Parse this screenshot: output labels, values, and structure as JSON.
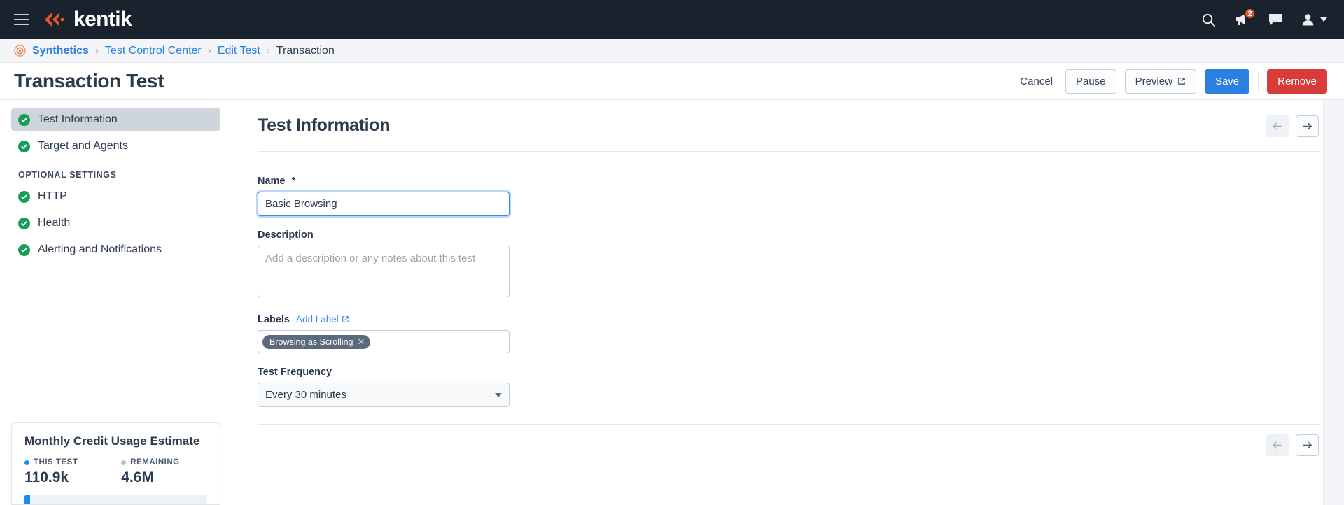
{
  "topbar": {
    "menu_icon": "hamburger-icon",
    "brand": "kentik",
    "icons": [
      {
        "name": "search-icon"
      },
      {
        "name": "megaphone-icon",
        "badge": "2"
      },
      {
        "name": "chat-icon"
      },
      {
        "name": "user-avatar-icon"
      }
    ]
  },
  "breadcrumb": {
    "app_icon": "synthetics-icon",
    "items": [
      {
        "label": "Synthetics",
        "type": "link"
      },
      {
        "label": "Test Control Center",
        "type": "link"
      },
      {
        "label": "Edit Test",
        "type": "link"
      },
      {
        "label": "Transaction",
        "type": "current"
      }
    ],
    "separator": "›"
  },
  "page": {
    "title": "Transaction Test",
    "actions": {
      "cancel": "Cancel",
      "pause": "Pause",
      "preview": "Preview",
      "save": "Save",
      "remove": "Remove"
    }
  },
  "sidebar": {
    "items": [
      {
        "label": "Test Information",
        "status": "complete",
        "active": true
      },
      {
        "label": "Target and Agents",
        "status": "complete",
        "active": false
      }
    ],
    "optional_group_title": "OPTIONAL SETTINGS",
    "optional_items": [
      {
        "label": "HTTP",
        "status": "complete"
      },
      {
        "label": "Health",
        "status": "complete"
      },
      {
        "label": "Alerting and Notifications",
        "status": "complete"
      }
    ],
    "credit_card": {
      "title": "Monthly Credit Usage Estimate",
      "this_test_label": "THIS TEST",
      "this_test_value": "110.9k",
      "remaining_label": "REMAINING",
      "remaining_value": "4.6M",
      "progress_percent": 3,
      "this_test_color": "#1a8cf0",
      "remaining_color": "#b6bfc9"
    }
  },
  "main": {
    "section_title": "Test Information",
    "nav": {
      "prev": "←",
      "next": "→",
      "prev_disabled": true,
      "next_disabled": false
    },
    "fields": {
      "name_label": "Name",
      "name_required_mark": "*",
      "name_value": "Basic Browsing",
      "description_label": "Description",
      "description_value": "",
      "description_placeholder": "Add a description or any notes about this test",
      "labels_label": "Labels",
      "add_label_link": "Add Label",
      "label_tags": [
        {
          "text": "Browsing as Scrolling",
          "remove": "✕"
        }
      ],
      "frequency_label": "Test Frequency",
      "frequency_value": "Every 30 minutes"
    }
  },
  "colors": {
    "brand_orange": "#e8542a",
    "nav_dark": "#19222d",
    "link_blue": "#2a7fe0",
    "primary_blue": "#2a7fe0",
    "danger_red": "#d93b3b",
    "success_green": "#189e5a"
  }
}
